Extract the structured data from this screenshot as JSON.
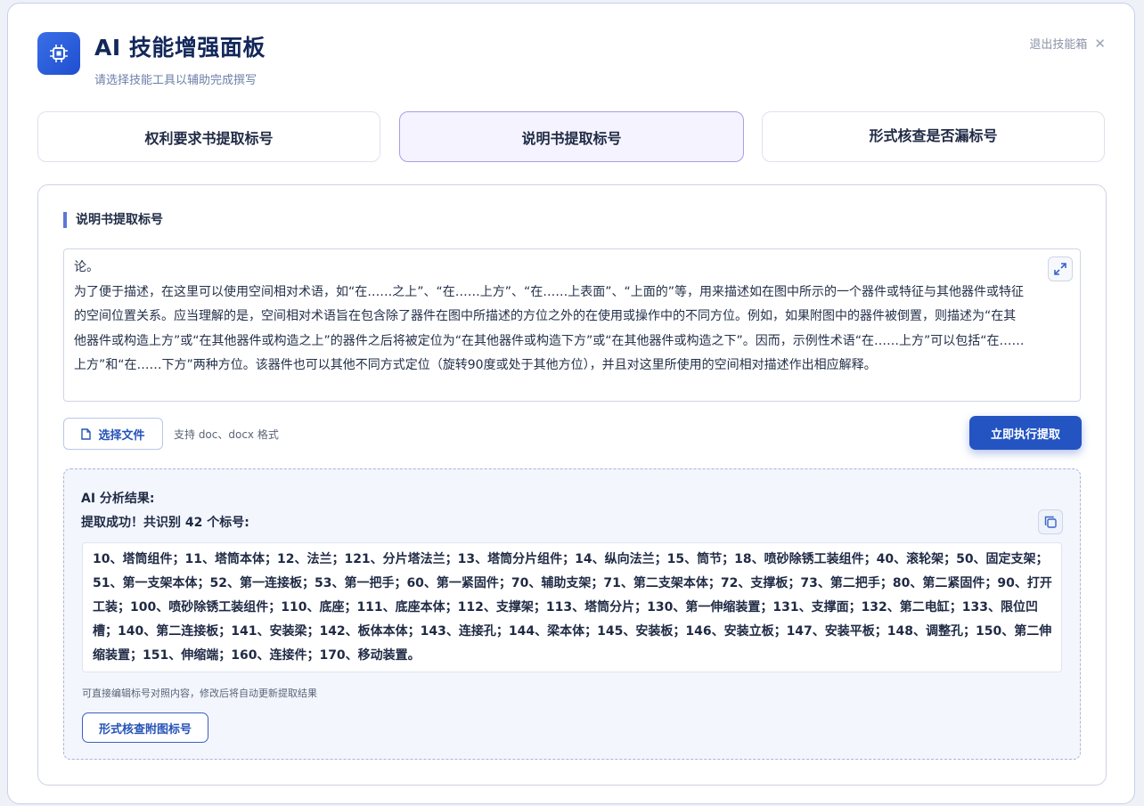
{
  "header": {
    "title": "AI 技能增强面板",
    "subtitle": "请选择技能工具以辅助完成撰写",
    "exit_label": "退出技能箱",
    "icon": "chip-icon"
  },
  "tabs": [
    {
      "label": "权利要求书提取标号",
      "active": false
    },
    {
      "label": "说明书提取标号",
      "active": true
    },
    {
      "label": "形式核查是否漏标号",
      "active": false
    }
  ],
  "panel": {
    "section_title": "说明书提取标号",
    "editor_text": "论。\n为了便于描述，在这里可以使用空间相对术语，如“在……之上”、“在……上方”、“在……上表面”、“上面的”等，用来描述如在图中所示的一个器件或特征与其他器件或特征的空间位置关系。应当理解的是，空间相对术语旨在包含除了器件在图中所描述的方位之外的在使用或操作中的不同方位。例如，如果附图中的器件被倒置，则描述为“在其他器件或构造上方”或“在其他器件或构造之上”的器件之后将被定位为“在其他器件或构造下方”或“在其他器件或构造之下”。因而，示例性术语“在……上方”可以包括“在……上方”和“在……下方”两种方位。该器件也可以其他不同方式定位（旋转90度或处于其他方位），并且对这里所使用的空间相对描述作出相应解释。",
    "file_button_label": "选择文件",
    "file_hint": "支持 doc、docx 格式",
    "run_button_label": "立即执行提取"
  },
  "result": {
    "heading": "AI 分析结果:",
    "summary": "提取成功！共识别 42 个标号:",
    "text": "10、塔筒组件；11、塔筒本体；12、法兰；121、分片塔法兰；13、塔筒分片组件；14、纵向法兰；15、筒节；18、喷砂除锈工装组件；40、滚轮架；50、固定支架；51、第一支架本体；52、第一连接板；53、第一把手；60、第一紧固件；70、辅助支架；71、第二支架本体；72、支撑板；73、第二把手；80、第二紧固件；90、打开工装；100、喷砂除锈工装组件；110、底座；111、底座本体；112、支撑架；113、塔筒分片；130、第一伸缩装置；131、支撑面；132、第二电缸；133、限位凹槽；140、第二连接板；141、安装梁；142、板体本体；143、连接孔；144、梁本体；145、安装板；146、安装立板；147、安装平板；148、调整孔；150、第二伸缩装置；151、伸缩端；160、连接件；170、移动装置。",
    "note": "可直接编辑标号对照内容，修改后将自动更新提取结果",
    "check_button_label": "形式核查附图标号"
  },
  "colors": {
    "accent": "#2354c2",
    "active_tab_bg": "#f4f3ff",
    "active_tab_border": "#a99ee6",
    "result_bg": "#f3f6fd"
  }
}
